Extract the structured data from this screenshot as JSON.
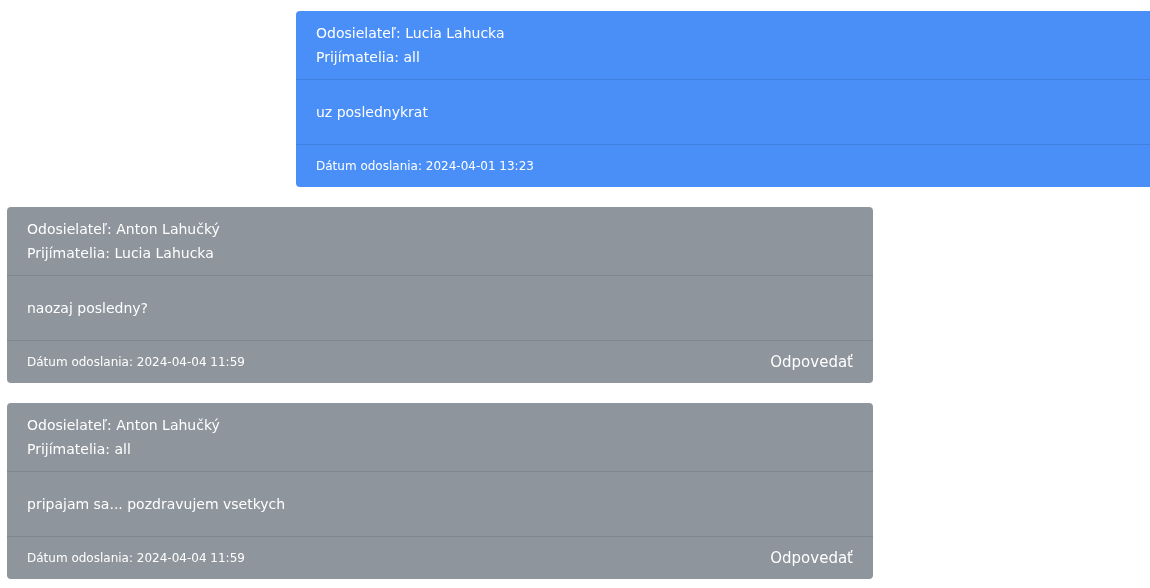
{
  "messages": [
    {
      "kind": "sent",
      "sender": "Odosielateľ: Lucia Lahucka",
      "recipients": "Prijímatelia: all",
      "body": "uz poslednykrat",
      "date": "Dátum odoslania: 2024-04-01 13:23"
    },
    {
      "kind": "received",
      "sender": "Odosielateľ: Anton Lahučký",
      "recipients": "Prijímatelia: Lucia Lahucka",
      "body": "naozaj posledny?",
      "date": "Dátum odoslania: 2024-04-04 11:59",
      "reply": "Odpovedať"
    },
    {
      "kind": "received",
      "sender": "Odosielateľ: Anton Lahučký",
      "recipients": "Prijímatelia: all",
      "body": "pripajam sa... pozdravujem vsetkych",
      "date": "Dátum odoslania: 2024-04-04 11:59",
      "reply": "Odpovedať"
    }
  ]
}
